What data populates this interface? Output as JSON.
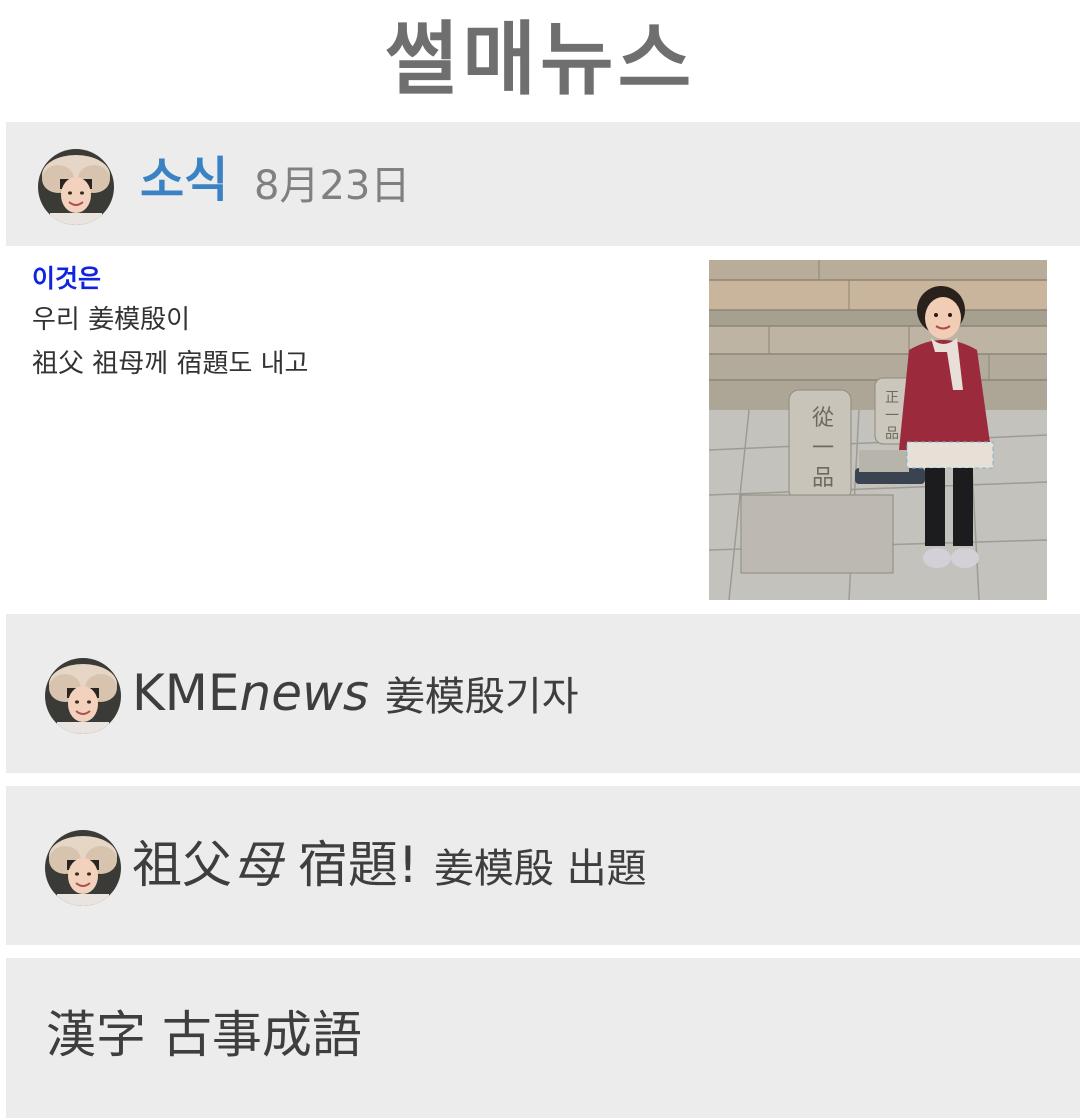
{
  "app": {
    "title": "썰매뉴스"
  },
  "news_header": {
    "label": "소식",
    "date": "8月23日"
  },
  "article": {
    "heading": "이것은",
    "lines": [
      "우리 姜模殷이",
      "祖父 祖母께 宿題도 내고"
    ]
  },
  "rows": [
    {
      "brand_plain": "KME",
      "brand_italic": "news",
      "subtitle": "姜模殷기자"
    },
    {
      "main_plain": "祖父",
      "main_italic": "母",
      "main_rest": " 宿題!",
      "subtitle": "姜模殷 出題"
    },
    {
      "text": "漢字 古事成語"
    }
  ],
  "icons": {
    "avatar": "child-avatar-icon"
  },
  "colors": {
    "header_label": "#3b82c4",
    "article_heading": "#1024e0",
    "bar_bg": "#ececec"
  }
}
